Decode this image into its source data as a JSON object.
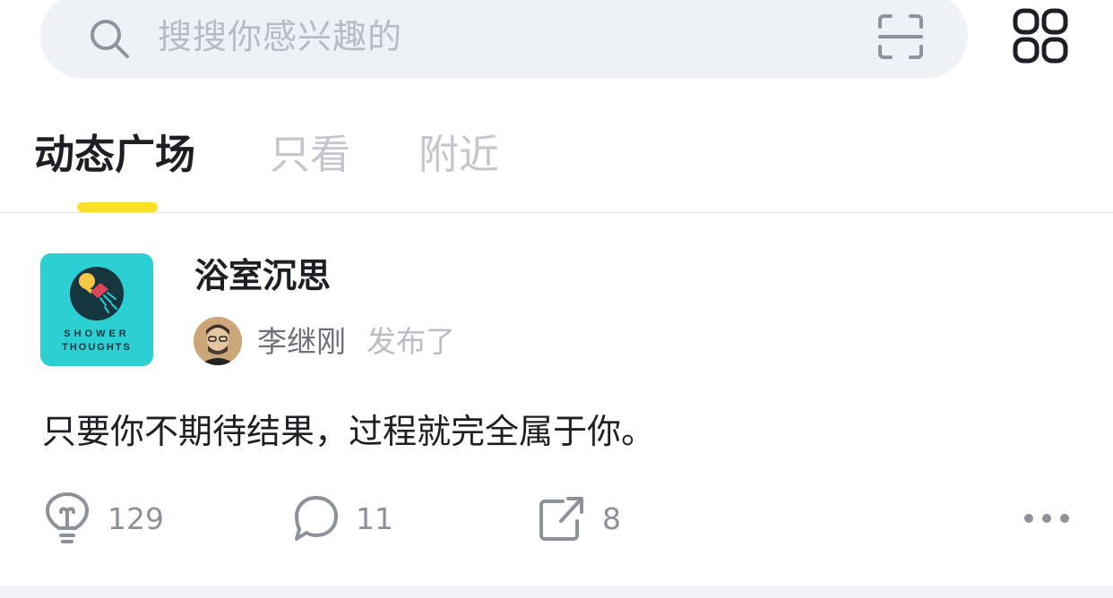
{
  "search": {
    "placeholder": "搜搜你感兴趣的",
    "left_icon": "search-icon",
    "right_icon": "scan-icon"
  },
  "header": {
    "menu_icon": "grid-icon"
  },
  "tabs": [
    {
      "label": "动态广场",
      "active": true
    },
    {
      "label": "只看",
      "active": false
    },
    {
      "label": "附近",
      "active": false
    }
  ],
  "colors": {
    "accent": "#fbe027",
    "search_bg": "#eef1f5",
    "text_primary": "#1c1f24",
    "text_muted": "#8d9199",
    "topic_logo_bg": "#2ccfd2"
  },
  "post": {
    "topic": {
      "name": "浴室沉思",
      "logo_text_line1": "SHOWER",
      "logo_text_line2": "THOUGHTS"
    },
    "author": {
      "name": "李继刚",
      "action": "发布了"
    },
    "content": "只要你不期待结果，过程就完全属于你。",
    "actions": {
      "like_count": "129",
      "comment_count": "11",
      "share_count": "8"
    }
  }
}
